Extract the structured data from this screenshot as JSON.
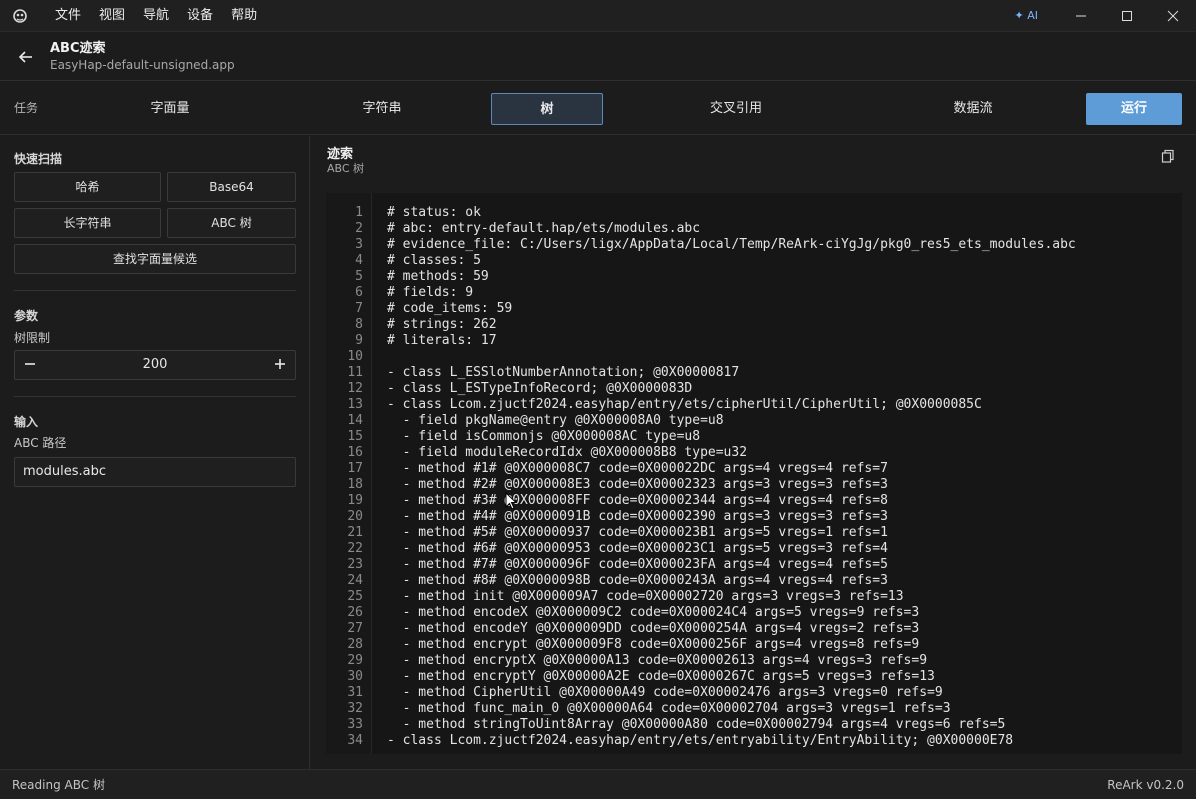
{
  "menubar": {
    "items": [
      "文件",
      "视图",
      "导航",
      "设备",
      "帮助"
    ],
    "ai_label": "✦ AI"
  },
  "header": {
    "title": "ABC迹索",
    "subtitle": "EasyHap-default-unsigned.app"
  },
  "taskbar": {
    "label": "任务",
    "tabs": [
      "字面量",
      "字符串",
      "树",
      "交叉引用",
      "数据流"
    ],
    "active_tab": "树",
    "run_label": "运行"
  },
  "sidebar": {
    "quick_scan_title": "快速扫描",
    "quick_buttons": [
      "哈希",
      "Base64",
      "长字符串",
      "ABC 树"
    ],
    "find_literal_button": "查找字面量候选",
    "params_title": "参数",
    "tree_limit_label": "树限制",
    "tree_limit_value": "200",
    "input_title": "输入",
    "abc_path_label": "ABC 路径",
    "abc_path_value": "modules.abc"
  },
  "main": {
    "title": "迹索",
    "subtitle": "ABC 树",
    "lines": [
      "# status: ok",
      "# abc: entry-default.hap/ets/modules.abc",
      "# evidence_file: C:/Users/ligx/AppData/Local/Temp/ReArk-ciYgJg/pkg0_res5_ets_modules.abc",
      "# classes: 5",
      "# methods: 59",
      "# fields: 9",
      "# code_items: 59",
      "# strings: 262",
      "# literals: 17",
      "",
      "- class L_ESSlotNumberAnnotation; @0X00000817",
      "- class L_ESTypeInfoRecord; @0X0000083D",
      "- class Lcom.zjuctf2024.easyhap/entry/ets/cipherUtil/CipherUtil; @0X0000085C",
      "  - field pkgName@entry @0X000008A0 type=u8",
      "  - field isCommonjs @0X000008AC type=u8",
      "  - field moduleRecordIdx @0X000008B8 type=u32",
      "  - method #1# @0X000008C7 code=0X000022DC args=4 vregs=4 refs=7",
      "  - method #2# @0X000008E3 code=0X00002323 args=3 vregs=3 refs=3",
      "  - method #3# @0X000008FF code=0X00002344 args=4 vregs=4 refs=8",
      "  - method #4# @0X0000091B code=0X00002390 args=3 vregs=3 refs=3",
      "  - method #5# @0X00000937 code=0X000023B1 args=5 vregs=1 refs=1",
      "  - method #6# @0X00000953 code=0X000023C1 args=5 vregs=3 refs=4",
      "  - method #7# @0X0000096F code=0X000023FA args=4 vregs=4 refs=5",
      "  - method #8# @0X0000098B code=0X0000243A args=4 vregs=4 refs=3",
      "  - method init @0X000009A7 code=0X00002720 args=3 vregs=3 refs=13",
      "  - method encodeX @0X000009C2 code=0X000024C4 args=5 vregs=9 refs=3",
      "  - method encodeY @0X000009DD code=0X0000254A args=4 vregs=2 refs=3",
      "  - method encrypt @0X000009F8 code=0X0000256F args=4 vregs=8 refs=9",
      "  - method encryptX @0X00000A13 code=0X00002613 args=4 vregs=3 refs=9",
      "  - method encryptY @0X00000A2E code=0X0000267C args=5 vregs=3 refs=13",
      "  - method CipherUtil @0X00000A49 code=0X00002476 args=3 vregs=0 refs=9",
      "  - method func_main_0 @0X00000A64 code=0X00002704 args=3 vregs=1 refs=3",
      "  - method stringToUint8Array @0X00000A80 code=0X00002794 args=4 vregs=6 refs=5",
      "- class Lcom.zjuctf2024.easyhap/entry/ets/entryability/EntryAbility; @0X00000E78"
    ]
  },
  "statusbar": {
    "left": "Reading ABC 树",
    "right": "ReArk v0.2.0"
  },
  "colors": {
    "accent": "#5d9cd6",
    "background": "#1c1c1c",
    "active_tab_border": "#5b88b8"
  }
}
